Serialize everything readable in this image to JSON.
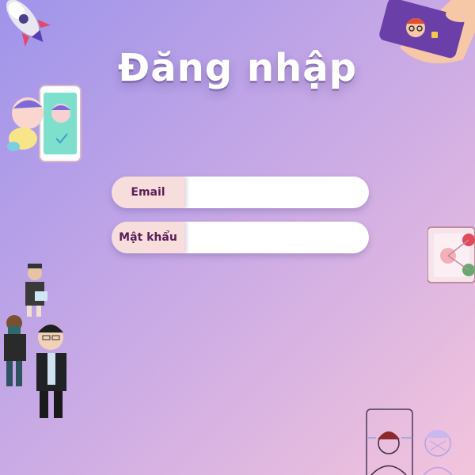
{
  "page": {
    "title": "Đăng nhập"
  },
  "form": {
    "email_label": "Email",
    "email_value": "",
    "password_label": "Mật khẩu",
    "password_value": ""
  },
  "colors": {
    "label_text": "#5a1f56",
    "label_bg": "#f7dedc",
    "bg_start": "#9f94ea",
    "bg_end": "#f3c4dc"
  },
  "decorations": [
    "rocket-icon",
    "hand-holding-phone-illustration",
    "baby-with-phone-illustration",
    "people-group-illustration",
    "social-network-card-illustration",
    "face-recognition-illustration"
  ]
}
